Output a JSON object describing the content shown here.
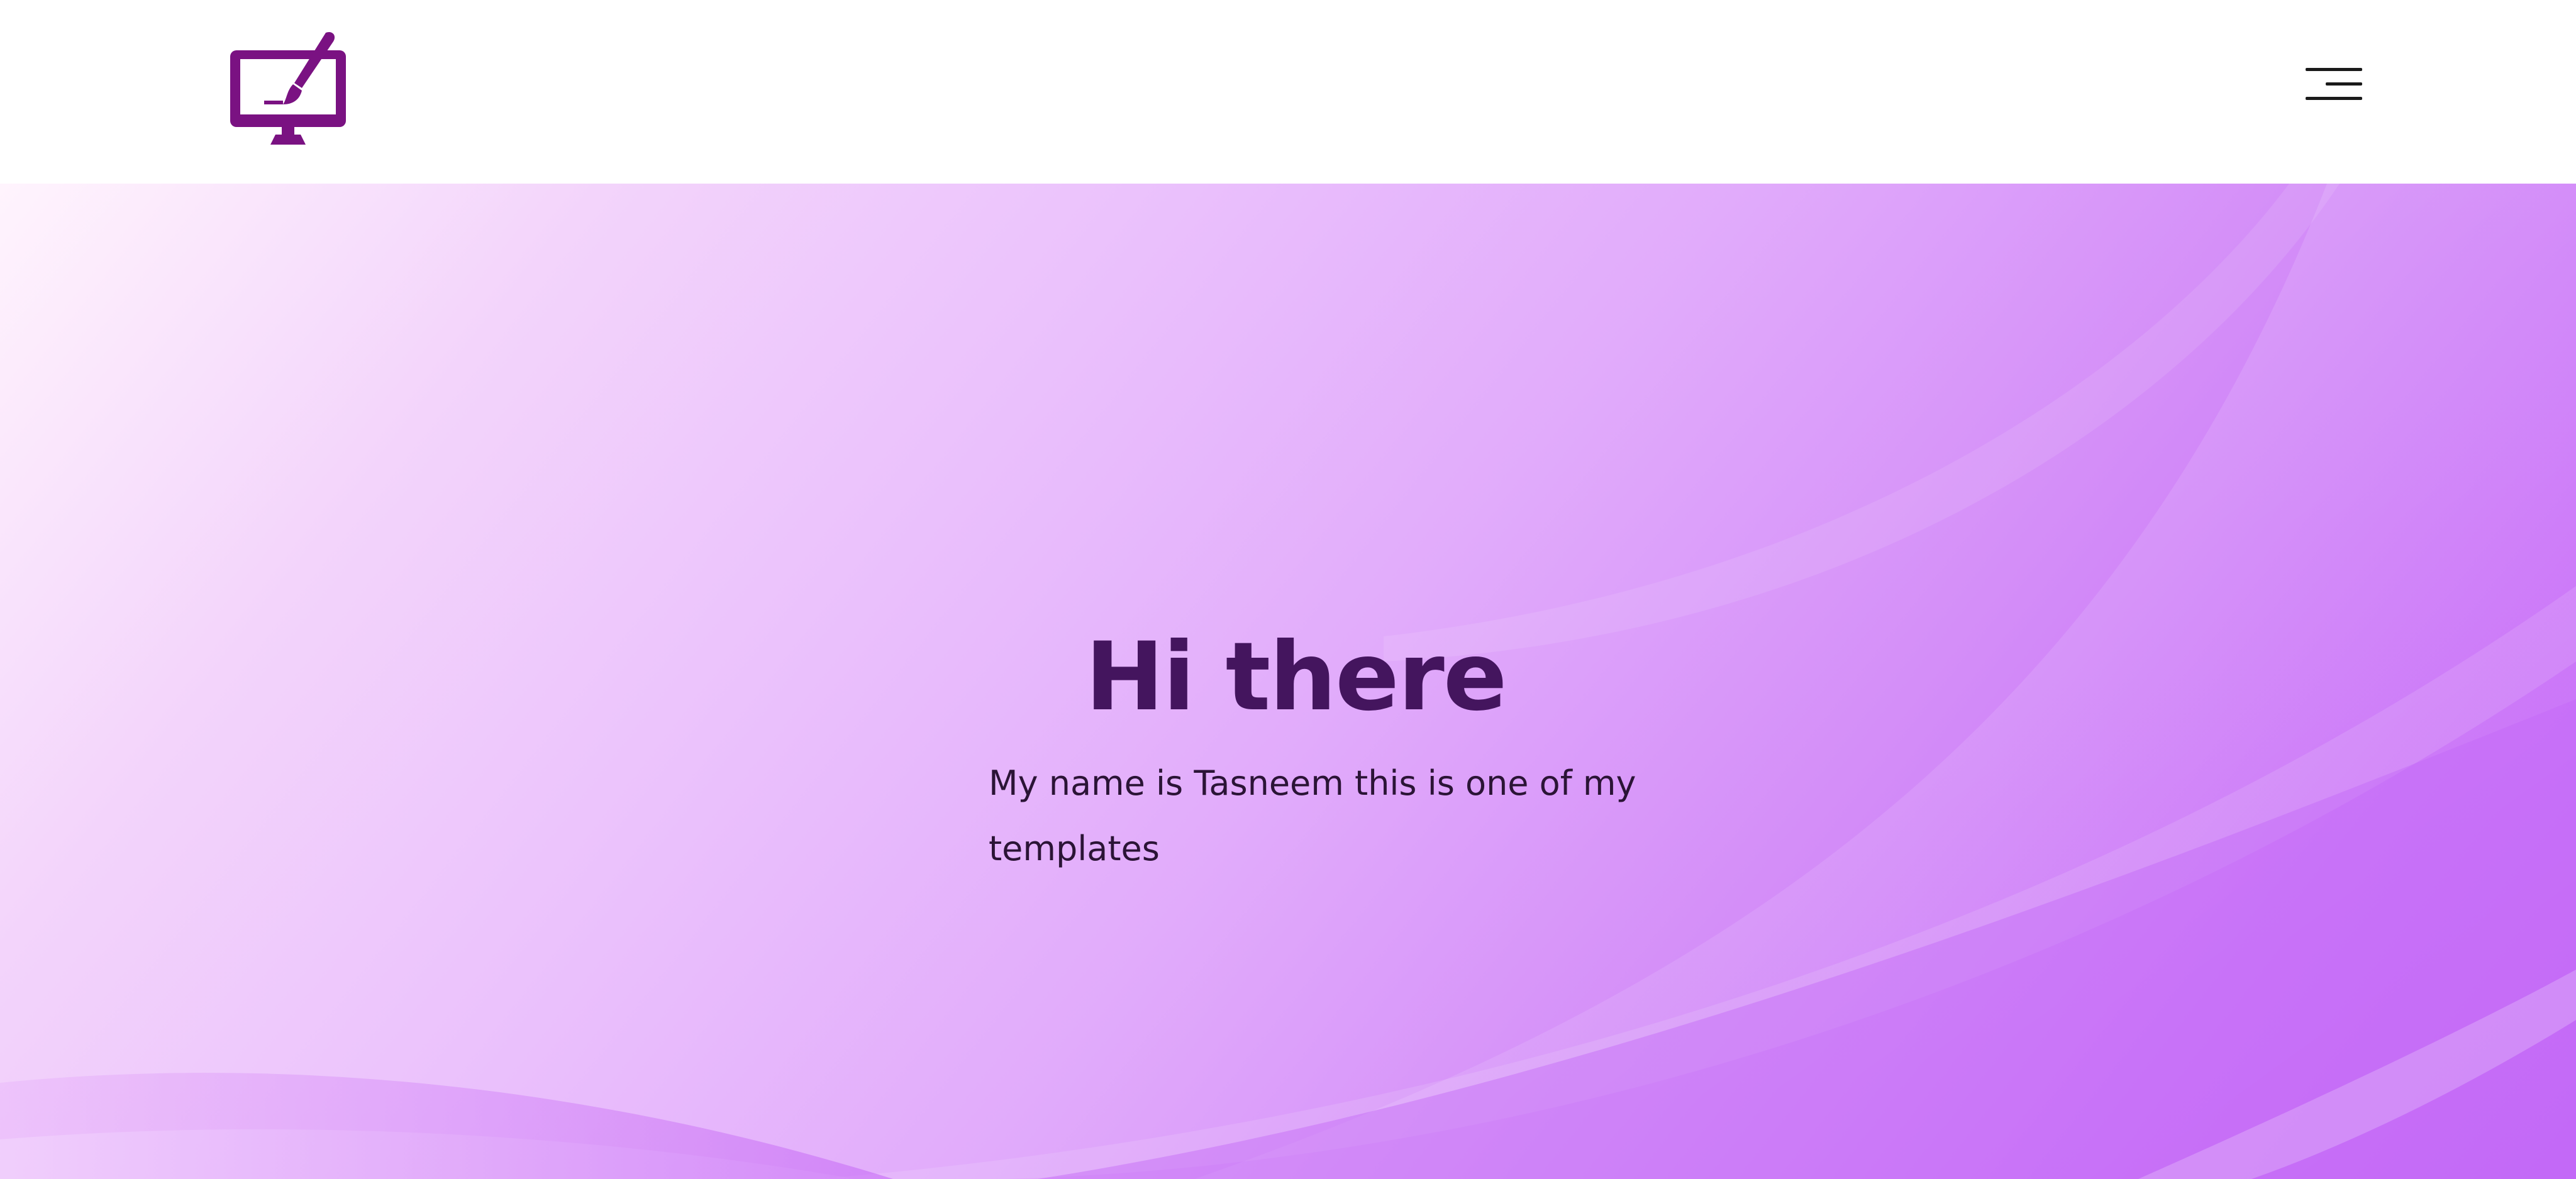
{
  "header": {
    "logo_icon": "monitor-paintbrush-icon",
    "menu_icon": "hamburger-menu-icon"
  },
  "hero": {
    "title": "Hi there",
    "subtitle": "My name is Tasneem this is one of my templates"
  },
  "colors": {
    "brand": "#7a1282",
    "title": "#44155e",
    "text": "#2b1436",
    "gradient_start": "#fff4fd",
    "gradient_end": "#c062f7"
  }
}
